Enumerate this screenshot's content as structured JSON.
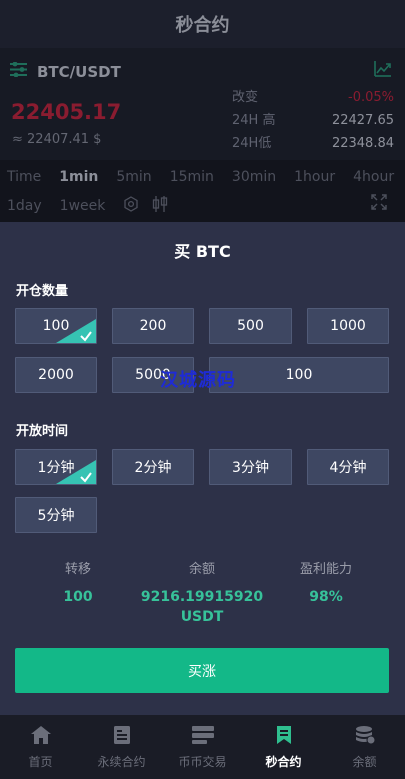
{
  "header": {
    "title": "秒合约"
  },
  "ticker": {
    "pair": "BTC/USDT",
    "price": "22405.17",
    "approx": "≈ 22407.41 $",
    "change_label": "改变",
    "change_value": "-0.05%",
    "high_label": "24H 高",
    "high_value": "22427.65",
    "low_label": "24H低",
    "low_value": "22348.84"
  },
  "timeframes": {
    "row1": [
      "Time",
      "1min",
      "5min",
      "15min",
      "30min",
      "1hour",
      "4hour"
    ],
    "row2": [
      "1day",
      "1week"
    ],
    "active": "1min"
  },
  "modal": {
    "title": "买 BTC",
    "quantity_label": "开仓数量",
    "quantities": [
      "100",
      "200",
      "500",
      "1000",
      "2000",
      "5000"
    ],
    "quantity_input": "100",
    "selected_quantity": "100",
    "time_label": "开放时间",
    "times": [
      "1分钟",
      "2分钟",
      "3分钟",
      "4分钟",
      "5分钟"
    ],
    "selected_time": "1分钟",
    "watermark": "汉城源码",
    "summary": {
      "transfer_label": "转移",
      "transfer_value": "100",
      "balance_label": "余额",
      "balance_value": "9216.19915920",
      "balance_unit": "USDT",
      "profit_label": "盈利能力",
      "profit_value": "98%"
    },
    "buy_button": "买涨"
  },
  "nav": {
    "items": [
      {
        "label": "首页",
        "icon": "home-icon"
      },
      {
        "label": "永续合约",
        "icon": "contract-icon"
      },
      {
        "label": "币币交易",
        "icon": "exchange-icon"
      },
      {
        "label": "秒合约",
        "icon": "bookmark-icon"
      },
      {
        "label": "余额",
        "icon": "coins-icon"
      }
    ],
    "active": "秒合约"
  },
  "colors": {
    "accent_green": "#13b888",
    "selected_corner": "#36c3b3",
    "price_red": "#8a1c30",
    "value_green": "#37c29a"
  }
}
